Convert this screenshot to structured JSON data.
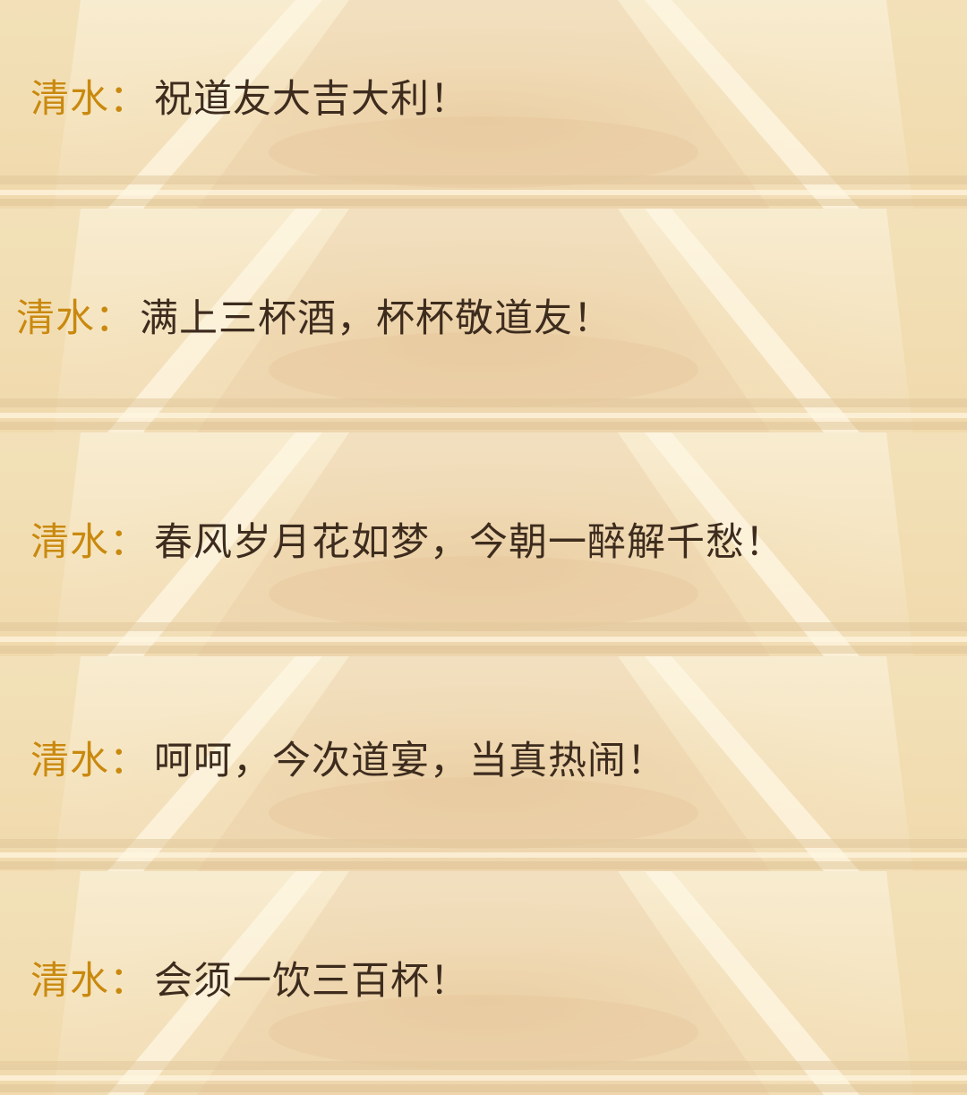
{
  "dialogue": {
    "messages": [
      {
        "speaker": "清水",
        "separator": "：",
        "text": "祝道友大吉大利！"
      },
      {
        "speaker": "清水",
        "separator": "：",
        "text": "满上三杯酒，杯杯敬道友！"
      },
      {
        "speaker": "清水",
        "separator": "：",
        "text": "春风岁月花如梦，今朝一醉解千愁！"
      },
      {
        "speaker": "清水",
        "separator": "：",
        "text": "呵呵，今次道宴，当真热闹！"
      },
      {
        "speaker": "清水",
        "separator": "：",
        "text": "会须一饮三百杯！"
      }
    ]
  },
  "colors": {
    "speaker": "#c9890f",
    "message": "#3d2c1e",
    "background": "#f6e8c8"
  }
}
